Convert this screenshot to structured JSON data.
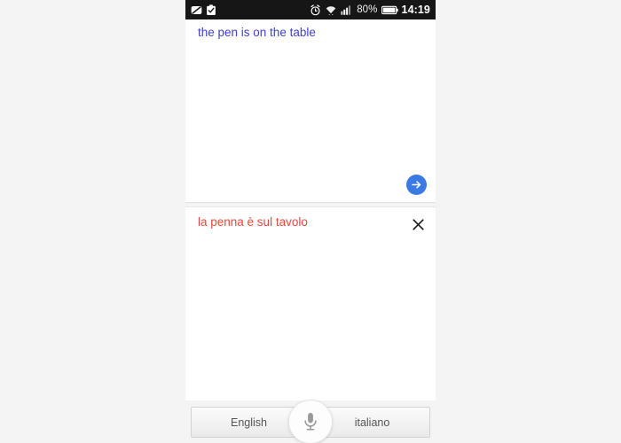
{
  "background_color": "#f4f4f4",
  "status_bar": {
    "background_color": "#161616",
    "left_icons": [
      {
        "name": "mute-icon",
        "label": "Mute"
      },
      {
        "name": "clipboard-check-icon",
        "label": "Clipboard"
      }
    ],
    "right_icons": [
      {
        "name": "alarm-clock-icon",
        "label": "Alarm"
      },
      {
        "name": "wifi-icon",
        "label": "Wi-Fi"
      },
      {
        "name": "signal-bars-icon",
        "label": "Signal"
      }
    ],
    "battery_percent": "80%",
    "battery_icon": "battery-icon",
    "time": "14:19"
  },
  "source": {
    "text": "the pen is on the table",
    "text_color": "#4040c8",
    "go_button_label": "Translate",
    "go_icon": "arrow-right-icon",
    "go_button_color": "#3b7ae4"
  },
  "target": {
    "text": "la penna è sul tavolo",
    "text_color": "#ea453c",
    "clear_button_label": "Clear",
    "clear_icon": "close-icon"
  },
  "language_bar": {
    "source_language": "English",
    "target_language": "italiano",
    "mic_label": "Speak",
    "mic_icon": "microphone-icon"
  }
}
